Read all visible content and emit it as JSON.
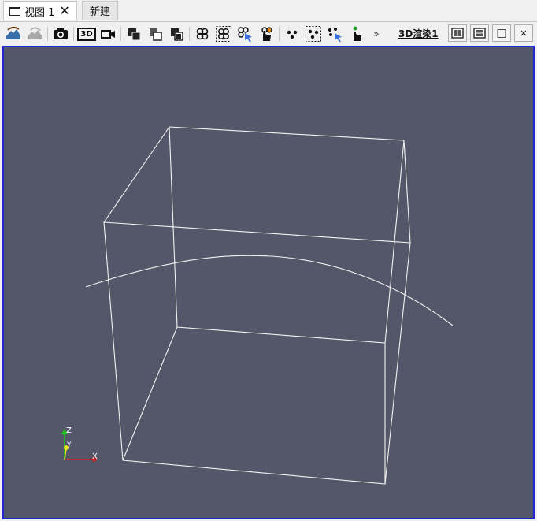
{
  "tabs": {
    "active_label": "视图 1",
    "close_glyph": "✕",
    "new_label": "新建"
  },
  "toolbar": {
    "tools": [
      "reset-camera-icon",
      "camera-undo-icon",
      "camera-snapshot-icon",
      "toggle-3d-icon",
      "video-camera-icon",
      "select-cells-on-icon",
      "select-cells-through-icon",
      "select-block-icon",
      "select-cell-polygon-icon",
      "select-cells-frustum-icon",
      "hover-cells-icon",
      "interactive-select-cells-icon",
      "select-points-on-icon",
      "select-points-frustum-icon",
      "hover-points-icon",
      "interactive-select-points-icon"
    ],
    "toggle_3d_text": "3D",
    "overflow_glyph": "»",
    "view_name": "3D渲染1",
    "controls": {
      "split_horizontal": "split-horizontal-icon",
      "split_vertical": "split-vertical-icon",
      "maximize_glyph": "□",
      "close_glyph": "✕"
    }
  },
  "view": {
    "background_color": "#545769",
    "border_color": "#1f27d6",
    "wireframe_color": "#f2f2f2",
    "axes": {
      "x_label": "X",
      "y_label": "Y",
      "z_label": "Z",
      "x_color": "#d11a1a",
      "y_color": "#e5e51c",
      "z_color": "#1fbf1f"
    }
  }
}
